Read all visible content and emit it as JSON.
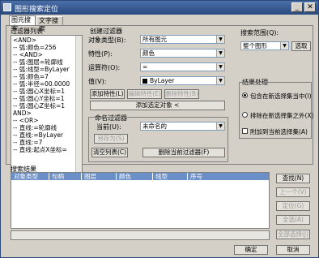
{
  "window": {
    "title": "图形搜索定位",
    "min_label": "_",
    "close_label": "✕"
  },
  "tabs": [
    {
      "label": "图元搜索",
      "active": true
    },
    {
      "label": "文字搜索",
      "active": false
    }
  ],
  "filter_list": {
    "label": "过滤器列表",
    "items": [
      "<AND>",
      "-- 弧:颜色=256",
      "-- <AND>",
      "   -- 弧:图层=轮廓线",
      "   -- 弧:线型=ByLayer",
      "   -- 弧:颜色=7",
      "   -- 弧:半径=00.0000",
      "   -- 弧:圆心X坐标=1",
      "   -- 弧:圆心Y坐标=1",
      "   -- 弧:圆心Z坐标=1",
      "   AND>",
      "-- <OR>",
      "   -- 直线:=轮廓线",
      "   -- 直线:=ByLayer",
      "   -- 直线:=7",
      "   -- 直线:起点X坐标="
    ]
  },
  "create_filter": {
    "label": "创建过滤器",
    "object_type_label": "对象类型(B):",
    "object_type_value": "所有图元",
    "property_label": "特性(P):",
    "property_value": "颜色",
    "operator_label": "运算符(O):",
    "operator_value": "=",
    "value_label": "值(V):",
    "value_value": "ByLayer",
    "add_property": "添加特性(L)",
    "edit_property": "编辑特性(E)",
    "delete_property": "删除特性(B)",
    "add_selected": "添加选定对象 <"
  },
  "named_filter": {
    "label": "命名过滤器",
    "current_label": "当前(U):",
    "current_value": "未命名的",
    "save_as": "另存为(S)",
    "clear_list": "清空列表(C)",
    "delete_current": "删除当前过滤器(F)"
  },
  "search_scope": {
    "label": "搜索范围(Q):",
    "value": "整个图形",
    "select_button": "选取"
  },
  "result_handling": {
    "label": "结果处理",
    "options": [
      {
        "label": "包含在新选择集当中(I)",
        "selected": true
      },
      {
        "label": "排除在新选择集之外(X)",
        "selected": false
      }
    ],
    "append_label": "附加到当前选择集(A)",
    "append_checked": false
  },
  "search_results": {
    "label": "搜索结果",
    "columns": [
      "对象类型",
      "句柄",
      "图层",
      "颜色",
      "线型",
      "序号"
    ]
  },
  "right_buttons": {
    "find": "查找(N)",
    "prev": "上一个(V)",
    "locate": "定位(G)",
    "select_all": "全选(A)",
    "all_select": "全部选择(J)"
  },
  "footer": {
    "ok": "确定",
    "cancel": "取消"
  },
  "colors": {
    "title_bar": "#29497e",
    "grid_header": "#6b8fc7",
    "dialog_bg": "#d4d0c8"
  }
}
